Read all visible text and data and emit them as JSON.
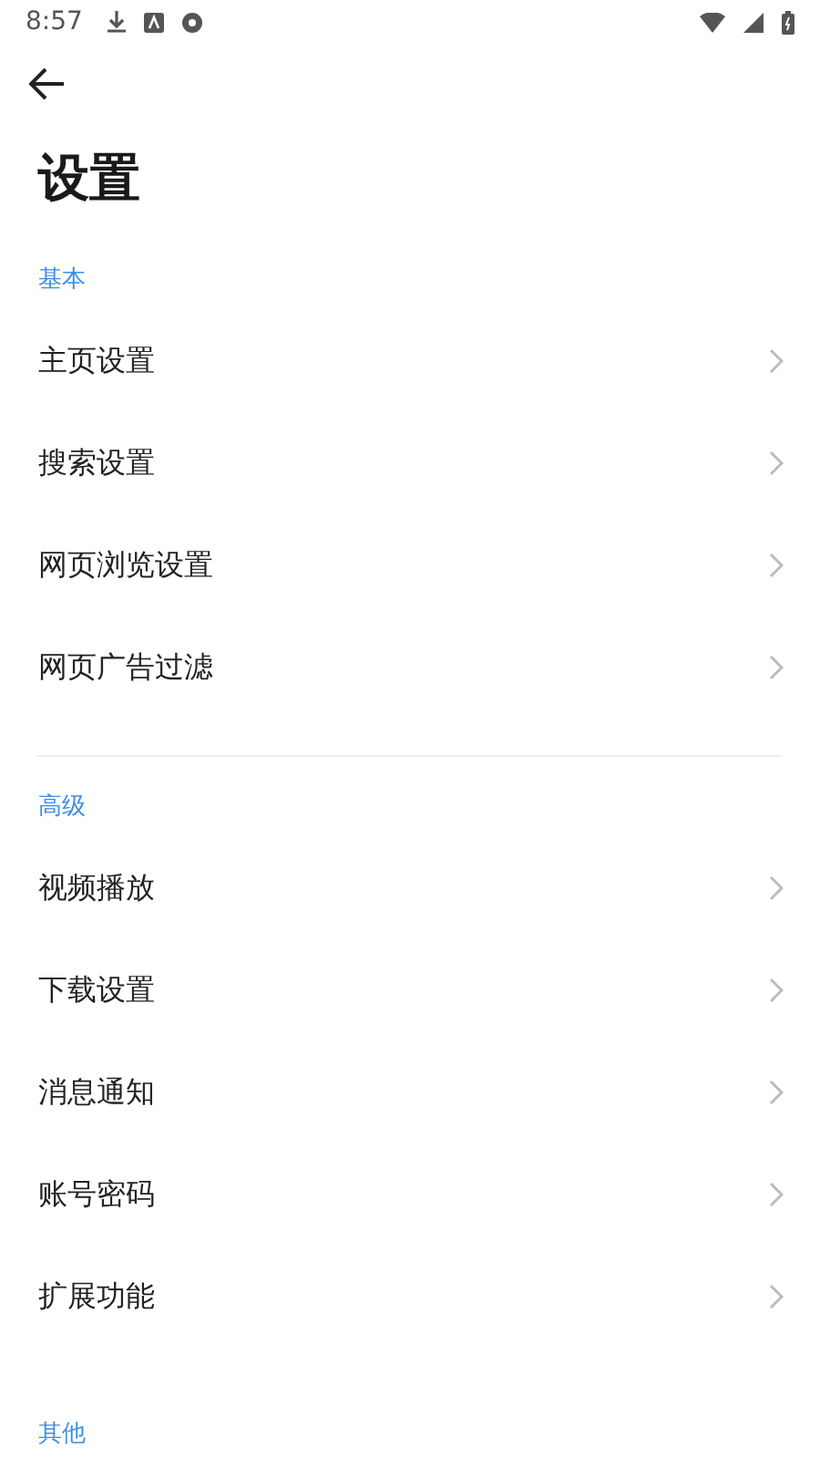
{
  "status_bar": {
    "time": "8:57"
  },
  "title": "设置",
  "sections": [
    {
      "label": "基本",
      "divider_after": true,
      "items": [
        {
          "label": "主页设置"
        },
        {
          "label": "搜索设置"
        },
        {
          "label": "网页浏览设置"
        },
        {
          "label": "网页广告过滤"
        }
      ]
    },
    {
      "label": "高级",
      "items": [
        {
          "label": "视频播放"
        },
        {
          "label": "下载设置"
        },
        {
          "label": "消息通知"
        },
        {
          "label": "账号密码"
        },
        {
          "label": "扩展功能"
        }
      ]
    },
    {
      "label": "其他"
    }
  ]
}
